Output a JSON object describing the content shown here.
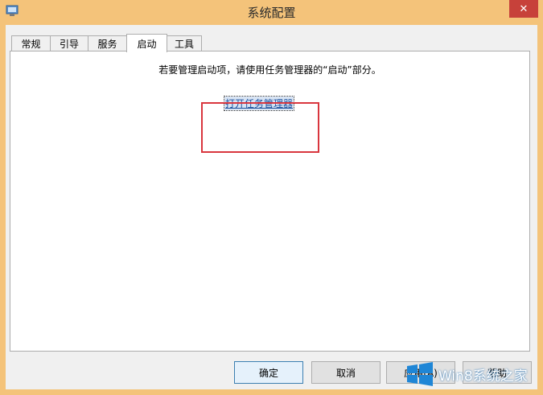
{
  "window": {
    "title": "系统配置",
    "close_glyph": "✕"
  },
  "tabs": [
    {
      "label": "常规"
    },
    {
      "label": "引导"
    },
    {
      "label": "服务"
    },
    {
      "label": "启动"
    },
    {
      "label": "工具"
    }
  ],
  "startup_panel": {
    "hint_text": "若要管理启动项，请使用任务管理器的“启动”部分。",
    "open_task_manager_link": "打开任务管理器"
  },
  "buttons": {
    "ok": "确定",
    "cancel": "取消",
    "apply": "应用(A)",
    "help": "帮助"
  },
  "watermark": {
    "text": "Win8系统之家"
  },
  "colors": {
    "window_frame": "#f4c37a",
    "close_button": "#c7413a",
    "highlight_box": "#d9363e",
    "link": "#1a4f9c"
  }
}
